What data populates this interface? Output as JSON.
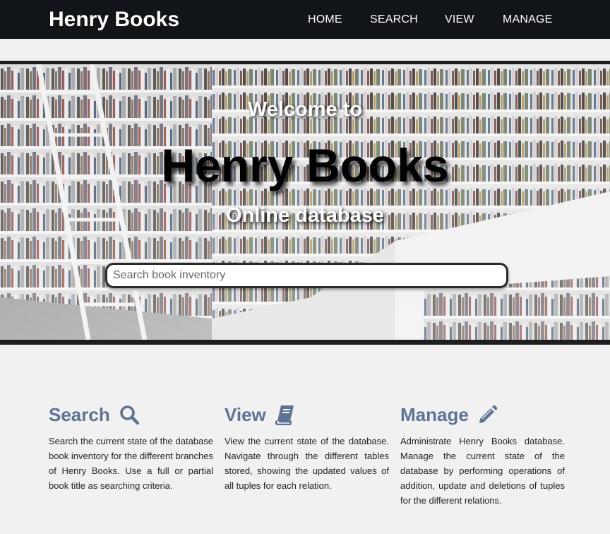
{
  "navbar": {
    "brand": "Henry Books",
    "items": [
      {
        "label": "HOME"
      },
      {
        "label": "SEARCH"
      },
      {
        "label": "VIEW"
      },
      {
        "label": "MANAGE"
      }
    ]
  },
  "hero": {
    "welcome": "Welcome to",
    "title": "Henry Books",
    "subtitle": "Online database",
    "search_placeholder": "Search book inventory",
    "search_value": ""
  },
  "features": [
    {
      "title": "Search",
      "icon": "search-icon",
      "text": "Search the current state of the database book inventory for the different branches of Henry Books. Use a full or partial book title as searching criteria."
    },
    {
      "title": "View",
      "icon": "book-icon",
      "text": "View the current state of the database. Navigate through the different tables stored, showing the updated values of all tuples for each relation."
    },
    {
      "title": "Manage",
      "icon": "pencil-icon",
      "text": "Administrate Henry Books database. Manage the current state of the database by performing operations of addition, update and deletions of tuples for the different relations."
    }
  ],
  "colors": {
    "navbar_bg": "#111418",
    "accent": "#5d7396",
    "page_bg": "#f1f1f1"
  }
}
